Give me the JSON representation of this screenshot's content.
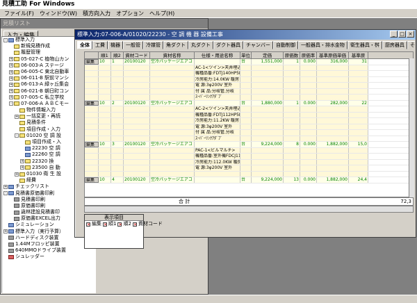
{
  "app": {
    "title": "見積工助 For Windows"
  },
  "menu": [
    "ファイル(F)",
    "ウィンドウ(W)",
    "積方向入力",
    "オプション",
    "ヘルプ(H)"
  ],
  "list_window": {
    "title": "見積リスト",
    "input_button": "入力・編集"
  },
  "tree": [
    {
      "indent": 0,
      "expander": "-",
      "icon": "tb",
      "label": "標準入力"
    },
    {
      "indent": 1,
      "expander": "",
      "icon": "tf",
      "label": "新規見積作成"
    },
    {
      "indent": 1,
      "expander": "",
      "icon": "tf",
      "label": "履歴管理"
    },
    {
      "indent": 1,
      "expander": "+",
      "icon": "tf",
      "label": "05-027-C 植物山カン"
    },
    {
      "indent": 1,
      "expander": "+",
      "icon": "tf",
      "label": "06-003-A ステージ"
    },
    {
      "indent": 1,
      "expander": "+",
      "icon": "tf",
      "label": "06-005-C 東北自動車"
    },
    {
      "indent": 1,
      "expander": "+",
      "icon": "tf",
      "label": "06-011-B 駅前マンシ"
    },
    {
      "indent": 1,
      "expander": "+",
      "icon": "tf",
      "label": "06-013-A 緑ヶ丘集会"
    },
    {
      "indent": 1,
      "expander": "+",
      "icon": "tf",
      "label": "06-021-B 朝日町コン"
    },
    {
      "indent": 1,
      "expander": "+",
      "icon": "tf",
      "label": "07-005-C 私立学校"
    },
    {
      "indent": 1,
      "expander": "-",
      "icon": "tf",
      "label": "07-006-A ＡＢＣモー"
    },
    {
      "indent": 2,
      "expander": "",
      "icon": "tf",
      "label": "物件情報入力"
    },
    {
      "indent": 2,
      "expander": "+",
      "icon": "tf",
      "label": "一括変更・再読"
    },
    {
      "indent": 2,
      "expander": "",
      "icon": "tf",
      "label": "見積条件"
    },
    {
      "indent": 2,
      "expander": "",
      "icon": "tf",
      "label": "項目作成・入力"
    },
    {
      "indent": 2,
      "expander": "-",
      "icon": "tf",
      "label": "01020 空 調 設"
    },
    {
      "indent": 3,
      "expander": "",
      "icon": "tf",
      "label": "項目作成・入"
    },
    {
      "indent": 3,
      "expander": "",
      "icon": "tb",
      "label": "22230 空 調"
    },
    {
      "indent": 3,
      "expander": "",
      "icon": "tb",
      "label": "22260 空 調"
    },
    {
      "indent": 3,
      "expander": "+",
      "icon": "tf",
      "label": "22320 換"
    },
    {
      "indent": 3,
      "expander": "+",
      "icon": "tf",
      "label": "23500 自 動"
    },
    {
      "indent": 2,
      "expander": "+",
      "icon": "tf",
      "label": "01030 衛 生 設"
    },
    {
      "indent": 2,
      "expander": "",
      "icon": "tf",
      "label": "経費"
    },
    {
      "indent": 0,
      "expander": "+",
      "icon": "tb",
      "label": "チェックリスト"
    },
    {
      "indent": 0,
      "expander": "-",
      "icon": "tb",
      "label": "見積書原価書印刷"
    },
    {
      "indent": 1,
      "expander": "",
      "icon": "tg",
      "label": "見積書印刷"
    },
    {
      "indent": 1,
      "expander": "",
      "icon": "tg",
      "label": "原価書印刷"
    },
    {
      "indent": 1,
      "expander": "",
      "icon": "tg",
      "label": "歳林建設見積書印"
    },
    {
      "indent": 1,
      "expander": "",
      "icon": "tg",
      "label": "原価書EXCEL出力"
    },
    {
      "indent": 0,
      "expander": "",
      "icon": "tb",
      "label": "シミュレーション"
    },
    {
      "indent": 0,
      "expander": "+",
      "icon": "tb",
      "label": "標準入力（実行予算）"
    },
    {
      "indent": 0,
      "expander": "",
      "icon": "tg",
      "label": "ハードディスク装置"
    },
    {
      "indent": 0,
      "expander": "",
      "icon": "tg",
      "label": "1.44Mフロッピ装置"
    },
    {
      "indent": 0,
      "expander": "",
      "icon": "tg",
      "label": "640MMOドライブ装置"
    },
    {
      "indent": 0,
      "expander": "",
      "icon": "tr",
      "label": "シュレッダー"
    }
  ],
  "std_window": {
    "title": "標準入力:07-006-A/01020/22230 - 空 調 機 器 設備工事"
  },
  "tabs": [
    "全体",
    "工費",
    "機器",
    "一般管",
    "冷媒管",
    "角ダクト",
    "丸ダクト",
    "ダクト器具",
    "チャンバー",
    "自動制御",
    "一般器具・排水金物",
    "衛生器具・桝",
    "厨房器具",
    "そ"
  ],
  "grid": {
    "headers": [
      "",
      "順1",
      "順2",
      "資材コード",
      "資材名称",
      "仕様・用途名称",
      "単位",
      "定価",
      "原価数",
      "原価率",
      "基準原価単価",
      "基準原"
    ],
    "rows": [
      {
        "kind": "main",
        "cells": [
          "編集",
          "10",
          "1",
          "20100120",
          "空冷パッケージエアコ",
          "",
          "台",
          "1,551,000",
          "1",
          "0.000",
          "316,000",
          "31"
        ]
      },
      {
        "kind": "spec",
        "text": "AC-1<ツイン>天井埋込"
      },
      {
        "kind": "spec",
        "text": "機種品番:FDTJ140HP5D8"
      },
      {
        "kind": "spec",
        "text": "冷房能力:14.0KW 暖房"
      },
      {
        "kind": "spec",
        "text": "電 源:3φ200V 室外"
      },
      {
        "kind": "spec",
        "text": "付 属 品:分岐管,分岐"
      },
      {
        "kind": "spec",
        "text": "ｽｰﾊﾟｰﾘﾝｸｱﾀﾞﾌﾟ"
      },
      {
        "kind": "main",
        "cells": [
          "編集",
          "10",
          "2",
          "20100120",
          "空冷パッケージエアコ",
          "",
          "台",
          "1,880,000",
          "1",
          "0.000",
          "282,000",
          "22"
        ]
      },
      {
        "kind": "spec",
        "text": "AC-2<ツイン>天井埋込"
      },
      {
        "kind": "spec",
        "text": "機種品番:FDTJ112HP5D8"
      },
      {
        "kind": "spec",
        "text": "冷房能力:11.2KW 暖房"
      },
      {
        "kind": "spec",
        "text": "電 源:3φ200V 室外"
      },
      {
        "kind": "spec",
        "text": "付 属 品:分岐管,分岐"
      },
      {
        "kind": "spec",
        "text": "ｽｰﾊﾟｰﾘﾝｸｱﾀﾞﾌﾟ"
      },
      {
        "kind": "main",
        "cells": [
          "編集",
          "10",
          "3",
          "20100120",
          "空冷パッケージエアコ",
          "",
          "台",
          "9,224,000",
          "8",
          "0.000",
          "1,882,000",
          "15,0"
        ]
      },
      {
        "kind": "spec",
        "text": "PAC-1<ビルマルチ>"
      },
      {
        "kind": "spec",
        "text": "機種品番:室外機FDCJ11"
      },
      {
        "kind": "spec",
        "text": "冷房能力:112.0KW 暖房"
      },
      {
        "kind": "spec",
        "text": "電 源:3φ200V 室外"
      },
      {
        "kind": "spec",
        "text": ""
      },
      {
        "kind": "main",
        "cells": [
          "編集",
          "10",
          "4",
          "20100120",
          "空冷パッケージエアコ",
          "",
          "台",
          "9,224,000",
          "13",
          "0.000",
          "1,882,000",
          "24,4"
        ]
      }
    ],
    "total_label": "合 計",
    "total_value": "72,3"
  },
  "display_items": {
    "title": "表示項目",
    "items": [
      {
        "label": "編集",
        "checked": true
      },
      {
        "label": "順1",
        "checked": true
      },
      {
        "label": "順2",
        "checked": true
      },
      {
        "label": "資材コード",
        "checked": true
      }
    ]
  }
}
